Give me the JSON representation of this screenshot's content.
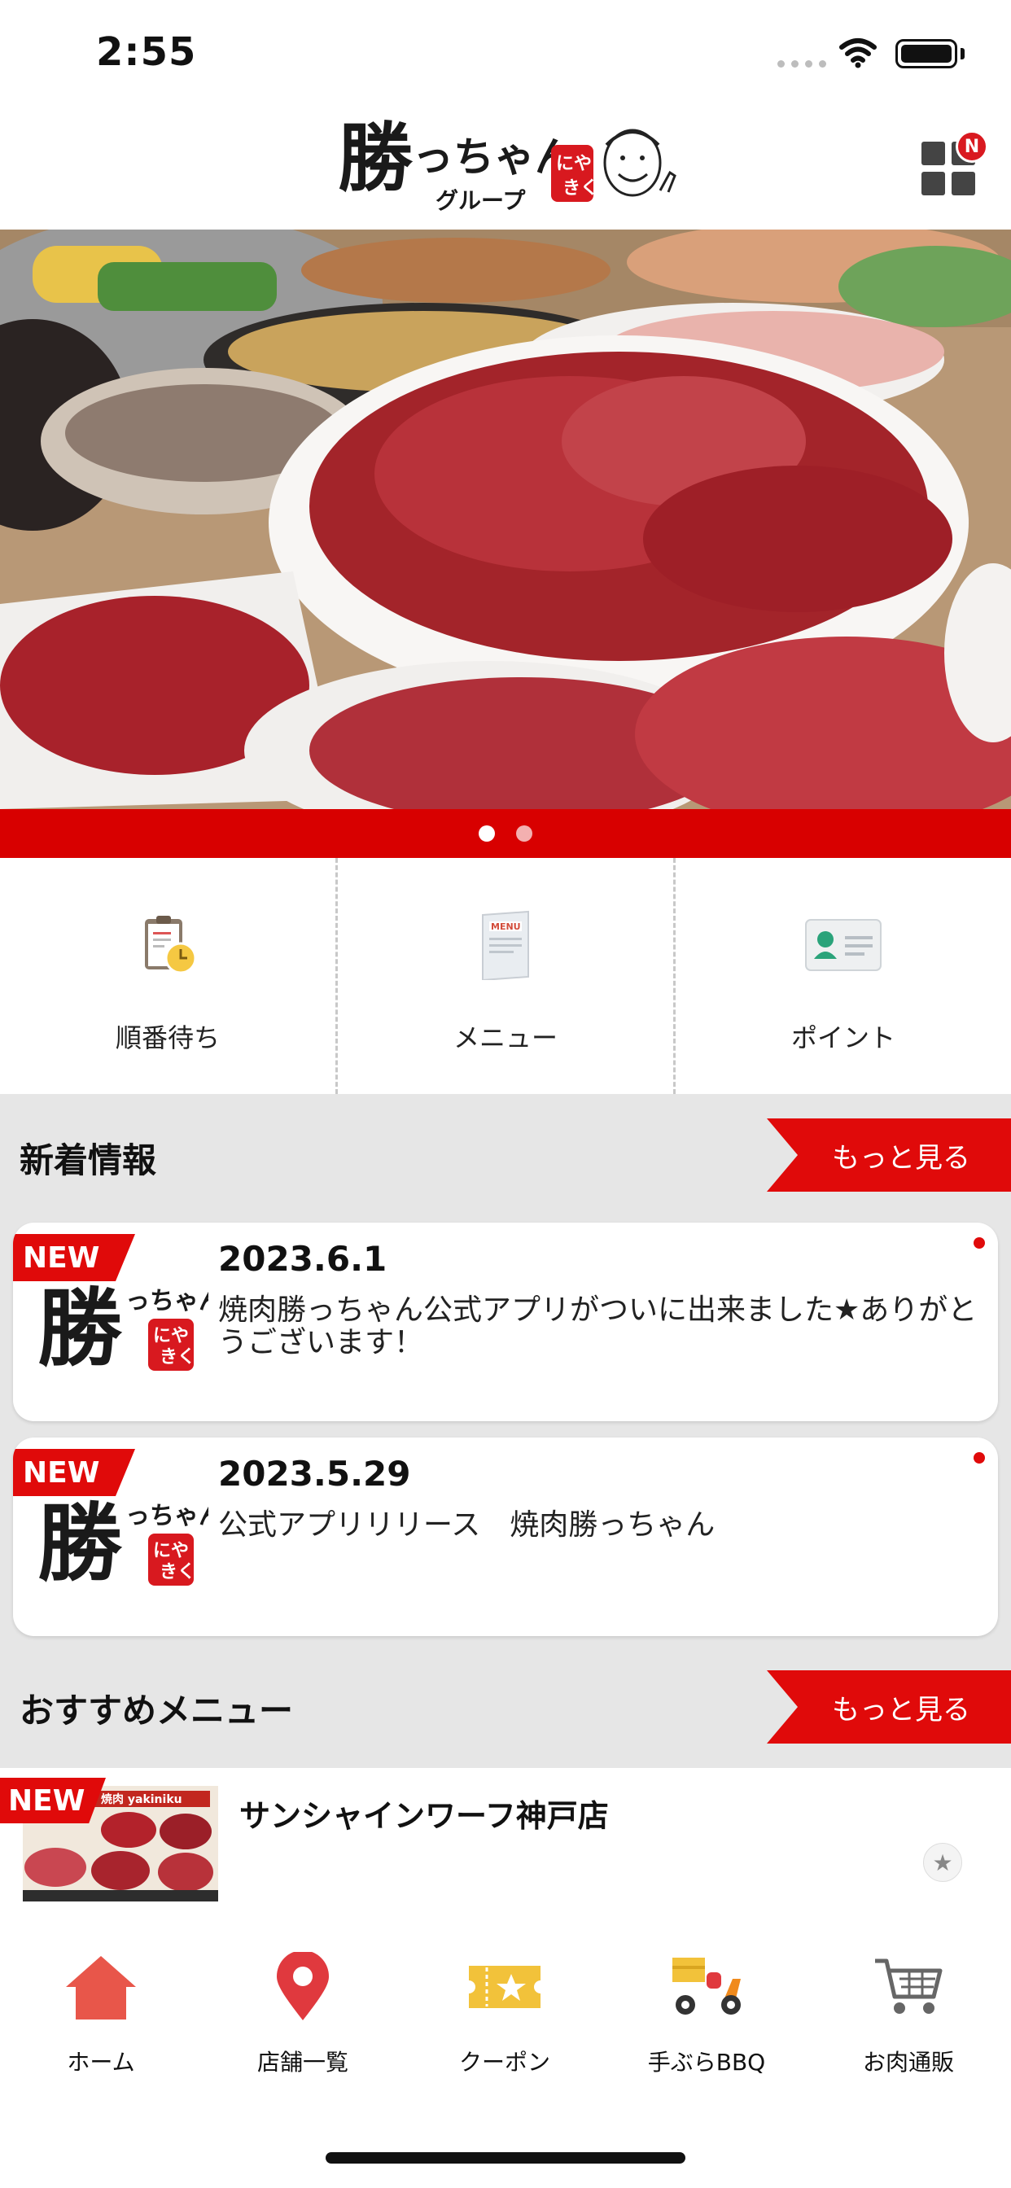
{
  "status": {
    "time": "2:55"
  },
  "header": {
    "logo_text": "勝っちゃん",
    "logo_group": "グループ",
    "logo_badge": "にやき く",
    "notif_badge": "N"
  },
  "hero": {
    "pages": 2,
    "active_page": 1
  },
  "quick_actions": [
    {
      "label": "順番待ち",
      "icon": "clipboard-clock-icon"
    },
    {
      "label": "メニュー",
      "icon": "menu-book-icon"
    },
    {
      "label": "ポイント",
      "icon": "member-card-icon"
    }
  ],
  "news": {
    "title": "新着情報",
    "more_label": "もっと見る",
    "items": [
      {
        "tag": "NEW",
        "date": "2023.6.1",
        "text": "焼肉勝っちゃん公式アプリがついに出来ました★ありがとうございます！"
      },
      {
        "tag": "NEW",
        "date": "2023.5.29",
        "text": "公式アプリリリース　焼肉勝っちゃん"
      }
    ]
  },
  "recommend": {
    "title": "おすすめメニュー",
    "more_label": "もっと見る",
    "items": [
      {
        "tag": "NEW",
        "name": "サンシャインワーフ神戸店",
        "thumb_label": "焼肉 yakiniku"
      }
    ]
  },
  "tabbar": [
    {
      "label": "ホーム",
      "icon": "home-icon",
      "color": "#e8564a"
    },
    {
      "label": "店舗一覧",
      "icon": "map-pin-icon",
      "color": "#e0393e"
    },
    {
      "label": "クーポン",
      "icon": "coupon-icon",
      "color": "#f2c23a"
    },
    {
      "label": "手ぶらBBQ",
      "icon": "delivery-scooter-icon",
      "color": "#f08a1c"
    },
    {
      "label": "お肉通販",
      "icon": "shopping-cart-icon",
      "color": "#666666"
    }
  ],
  "colors": {
    "accent": "#e00a0a",
    "pager": "#d80000",
    "section_bg": "#e6e6e6"
  }
}
